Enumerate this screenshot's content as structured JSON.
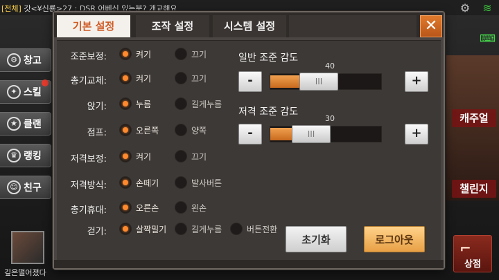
{
  "lobby": {
    "chat_tag": "[전체]",
    "chat_text": " 갓<¥신룡>27 : DSR 어베신 있는분? 개교해요",
    "left_menu": [
      {
        "label": "창고",
        "icon": "gear"
      },
      {
        "label": "스킬",
        "icon": "skill"
      },
      {
        "label": "클랜",
        "icon": "star"
      },
      {
        "label": "랭킹",
        "icon": "trophy"
      },
      {
        "label": "친구",
        "icon": "friend"
      }
    ],
    "player_name": "깊은떨어졌다",
    "right_labels": {
      "casual": "캐주얼",
      "challenge": "챌린지"
    },
    "shop_label": "상점"
  },
  "dialog": {
    "tabs": [
      "기본 설정",
      "조작 설정",
      "시스템 설정"
    ],
    "active_tab": 0,
    "close_label": "✕",
    "options": [
      {
        "label": "조준보정:",
        "choices": [
          "켜기",
          "끄기"
        ],
        "selected": 0
      },
      {
        "label": "총기교체:",
        "choices": [
          "켜기",
          "끄기"
        ],
        "selected": 0
      },
      {
        "label": "앉기:",
        "choices": [
          "누름",
          "길게누름"
        ],
        "selected": 0
      },
      {
        "label": "점프:",
        "choices": [
          "오른쪽",
          "양쪽"
        ],
        "selected": 0
      },
      {
        "label": "저격보정:",
        "choices": [
          "켜기",
          "끄기"
        ],
        "selected": 0
      },
      {
        "label": "저격방식:",
        "choices": [
          "손떼기",
          "발사버튼"
        ],
        "selected": 0
      },
      {
        "label": "총기휴대:",
        "choices": [
          "오른손",
          "왼손"
        ],
        "selected": 0
      },
      {
        "label": "걷기:",
        "choices": [
          "살짝밀기",
          "길게누름",
          "버튼전환"
        ],
        "selected": 0
      }
    ],
    "normal_sensitivity": {
      "title": "일반 조준 감도",
      "value": "40",
      "level": 40,
      "minus": "-",
      "plus": "+"
    },
    "sniper_sensitivity": {
      "title": "저격 조준 감도",
      "value": "30",
      "level": 30,
      "minus": "-",
      "plus": "+"
    },
    "thumb_grip": "III",
    "reset_label": "초기화",
    "logout_label": "로그아웃"
  }
}
